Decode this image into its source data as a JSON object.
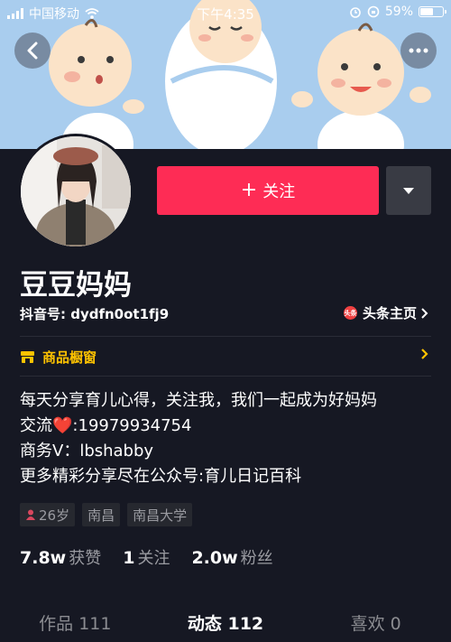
{
  "status_bar": {
    "carrier": "中国移动",
    "time": "下午4:35",
    "battery": "59%",
    "battery_level": 0.59
  },
  "profile": {
    "name": "豆豆妈妈",
    "douyin_id": "抖音号: dydfn0ot1fj9",
    "toutiao_icon_text": "头条",
    "toutiao_link": "头条主页",
    "follow_label": "关注",
    "follow_plus": "+"
  },
  "showcase": {
    "label": "商品橱窗"
  },
  "bio": {
    "line1": "每天分享育儿心得，关注我，我们一起成为好妈妈",
    "line2_prefix": "交流",
    "line2_heart": "❤️",
    "line2_suffix": ":19979934754",
    "line3": "商务V：lbshabby",
    "line4": "更多精彩分享尽在公众号:育儿日记百科"
  },
  "tags": {
    "age": "26岁",
    "city": "南昌",
    "school": "南昌大学"
  },
  "stats": {
    "likes_value": "7.8w",
    "likes_label": "获赞",
    "following_value": "1",
    "following_label": "关注",
    "fans_value": "2.0w",
    "fans_label": "粉丝"
  },
  "tabs": [
    {
      "label": "作品 111"
    },
    {
      "label": "动态 112"
    },
    {
      "label": "喜欢 0"
    }
  ],
  "colors": {
    "accent": "#fe2c55",
    "background": "#161823",
    "showcase": "#ffc300"
  }
}
